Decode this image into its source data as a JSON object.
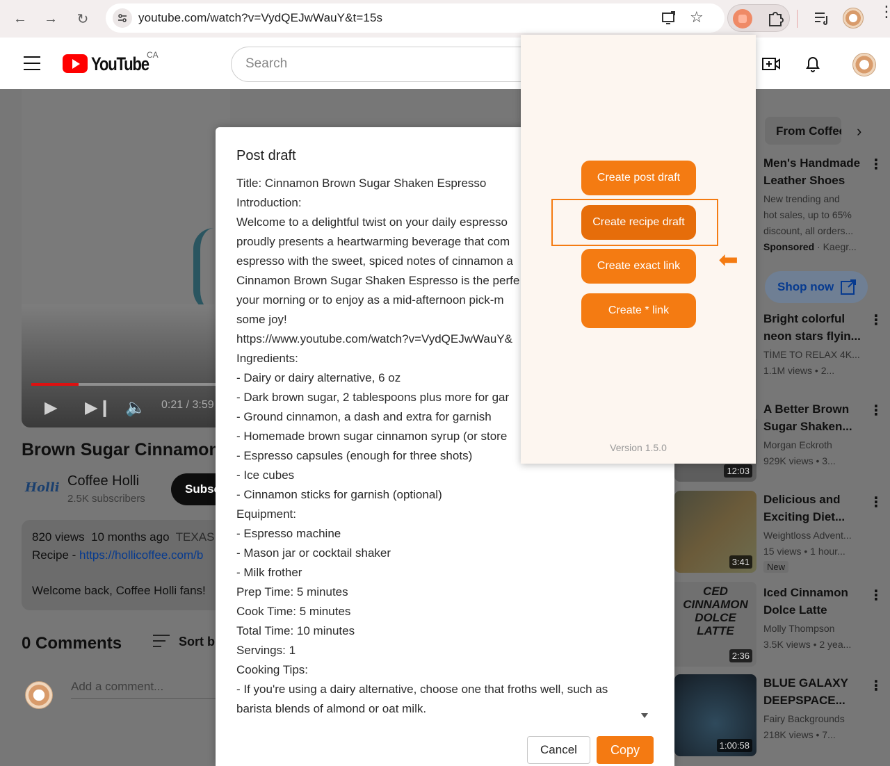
{
  "browser": {
    "url": "youtube.com/watch?v=VydQEJwWauY&t=15s"
  },
  "youtube": {
    "logo_text": "YouTube",
    "country": "CA",
    "search_placeholder": "Search"
  },
  "video": {
    "time": "0:21 / 3:59",
    "title": "Brown Sugar Cinnamon I",
    "channel_logo": "Holli",
    "channel_name": "Coffee Holli",
    "subscribers": "2.5K subscribers",
    "subscribe_label": "Subsc",
    "views": "820 views",
    "age": "10 months ago",
    "location": "TEXAS",
    "recipe_prefix": "Recipe - ",
    "recipe_link": "https://hollicoffee.com/b",
    "welcome": "Welcome back, Coffee Holli fans!",
    "comments_count": "0 Comments",
    "sort_label": "Sort b",
    "add_comment": "Add a comment..."
  },
  "rail": {
    "chip": "From Coffee",
    "items": [
      {
        "title1": "Men's Handmade",
        "title2": "Leather Shoes",
        "meta1": "New trending and",
        "meta2": "hot sales, up to 65%",
        "meta3": "discount, all orders...",
        "sponsored": "Sponsored",
        "sponsor": " · Kaegr..."
      },
      {
        "title1": "Bright colorful",
        "title2": "neon stars flyin...",
        "meta1": "TİME TO RELAX 4K...",
        "meta2": "1.1M views  • 2..."
      },
      {
        "title1": "A Better Brown",
        "title2": "Sugar Shaken...",
        "meta1": "Morgan Eckroth",
        "meta2": "929K views  • 3...",
        "duration": "12:03"
      },
      {
        "title1": "Delicious and",
        "title2": "Exciting Diet...",
        "meta1": "Weightloss Advent...",
        "meta2": "15 views  • 1 hour...",
        "badge": "New",
        "duration": "3:41"
      },
      {
        "title1": "Iced Cinnamon",
        "title2": "Dolce Latte",
        "meta1": "Molly Thompson",
        "meta2": "3.5K views  • 2 yea...",
        "duration": "2:36",
        "thumb_text": "CED CINNAMON DOLCE LATTE"
      },
      {
        "title1": "BLUE GALAXY",
        "title2": "DEEPSPACE...",
        "meta1": "Fairy Backgrounds",
        "meta2": "218K views  • 7...",
        "duration": "1:00:58"
      }
    ],
    "shop_now": "Shop now"
  },
  "modal": {
    "title": "Post draft",
    "lines": [
      "Title: Cinnamon Brown Sugar Shaken Espresso",
      "Introduction:",
      "Welcome to a delightful twist on your daily espresso",
      "proudly presents a heartwarming beverage that com",
      "espresso with the sweet, spiced notes of cinnamon a",
      "Cinnamon Brown Sugar Shaken Espresso is the perfe",
      "your morning or to enjoy as a mid-afternoon pick-m",
      "some joy!",
      "https://www.youtube.com/watch?v=VydQEJwWauY&",
      "Ingredients:",
      "- Dairy or dairy alternative, 6 oz",
      "- Dark brown sugar, 2 tablespoons plus more for gar",
      "- Ground cinnamon, a dash and extra for garnish",
      "- Homemade brown sugar cinnamon syrup (or store",
      "- Espresso capsules (enough for three shots)",
      "- Ice cubes",
      "- Cinnamon sticks for garnish (optional)",
      "Equipment:",
      "- Espresso machine",
      "- Mason jar or cocktail shaker",
      "- Milk frother",
      "Prep Time: 5 minutes",
      "Cook Time: 5 minutes",
      "Total Time: 10 minutes",
      "Servings: 1",
      "Cooking Tips:",
      "- If you're using a dairy alternative, choose one that froths well, such as",
      "barista blends of almond or oat milk."
    ],
    "cancel_label": "Cancel",
    "copy_label": "Copy"
  },
  "popup": {
    "buttons": [
      "Create post draft",
      "Create recipe draft",
      "Create exact link",
      "Create * link"
    ],
    "version": "Version 1.5.0"
  },
  "colors": {
    "accent": "#f47b12",
    "youtube_red": "#ff0000",
    "link": "#065fd4"
  }
}
